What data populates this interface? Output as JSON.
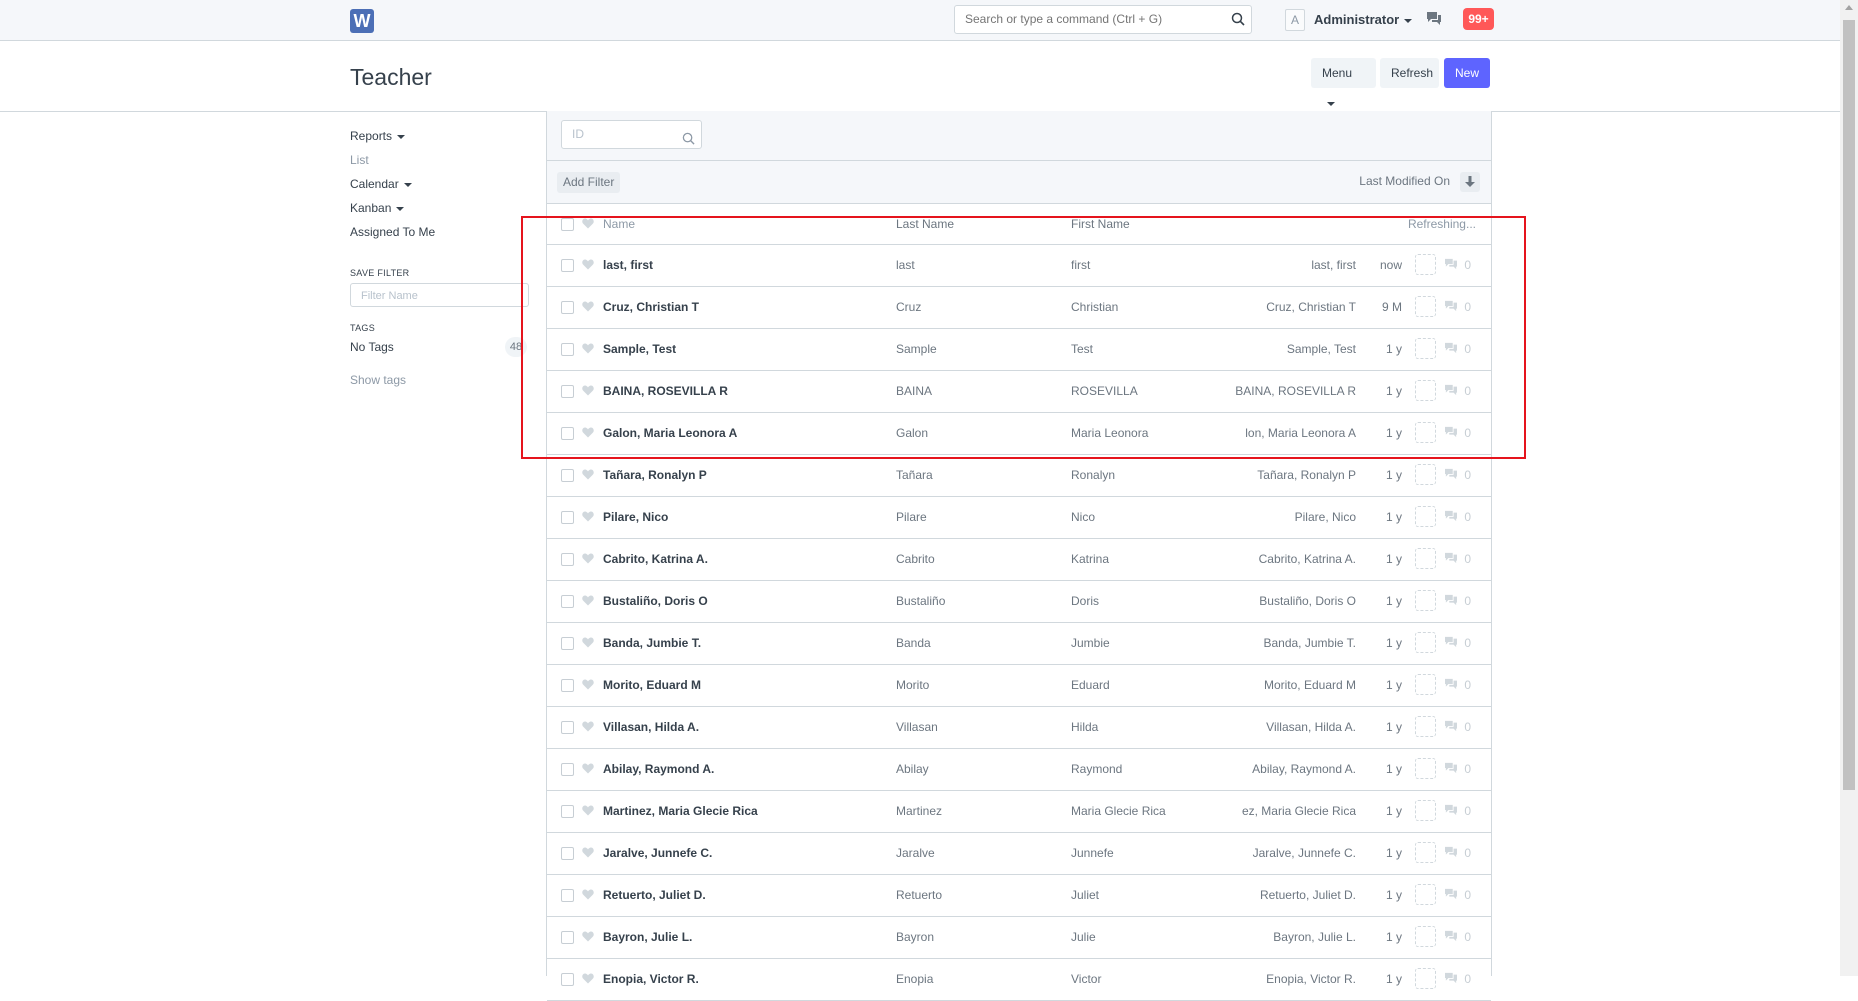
{
  "navbar": {
    "logo": "W",
    "search_placeholder": "Search or type a command (Ctrl + G)",
    "avatar_letter": "A",
    "user": "Administrator",
    "notifications": "99+"
  },
  "page": {
    "title": "Teacher",
    "menu_label": "Menu",
    "refresh_label": "Refresh",
    "new_label": "New"
  },
  "sidebar": {
    "reports": "Reports",
    "list": "List",
    "calendar": "Calendar",
    "kanban": "Kanban",
    "assigned": "Assigned To Me",
    "save_filter_label": "SAVE FILTER",
    "filter_name_placeholder": "Filter Name",
    "tags_label": "TAGS",
    "no_tags": "No Tags",
    "no_tags_count": "48",
    "show_tags": "Show tags"
  },
  "list": {
    "id_placeholder": "ID",
    "add_filter": "Add Filter",
    "sort_label": "Last Modified On",
    "columns": {
      "name": "Name",
      "last": "Last Name",
      "first": "First Name",
      "status": "Refreshing..."
    },
    "rows": [
      {
        "name": "last, first",
        "last": "last",
        "first": "first",
        "full": "last, first",
        "time": "now",
        "comments": "0"
      },
      {
        "name": "Cruz, Christian T",
        "last": "Cruz",
        "first": "Christian",
        "full": "Cruz, Christian T",
        "time": "9 M",
        "comments": "0"
      },
      {
        "name": "Sample, Test",
        "last": "Sample",
        "first": "Test",
        "full": "Sample, Test",
        "time": "1 y",
        "comments": "0"
      },
      {
        "name": "BAINA, ROSEVILLA R",
        "last": "BAINA",
        "first": "ROSEVILLA",
        "full": "BAINA, ROSEVILLA R",
        "time": "1 y",
        "comments": "0"
      },
      {
        "name": "Galon, Maria Leonora A",
        "last": "Galon",
        "first": "Maria Leonora",
        "full": "lon, Maria Leonora A",
        "time": "1 y",
        "comments": "0"
      },
      {
        "name": "Tañara, Ronalyn P",
        "last": "Tañara",
        "first": "Ronalyn",
        "full": "Tañara, Ronalyn P",
        "time": "1 y",
        "comments": "0"
      },
      {
        "name": "Pilare, Nico",
        "last": "Pilare",
        "first": "Nico",
        "full": "Pilare, Nico",
        "time": "1 y",
        "comments": "0"
      },
      {
        "name": "Cabrito, Katrina A.",
        "last": "Cabrito",
        "first": "Katrina",
        "full": "Cabrito, Katrina A.",
        "time": "1 y",
        "comments": "0"
      },
      {
        "name": "Bustaliño, Doris O",
        "last": "Bustaliño",
        "first": "Doris",
        "full": "Bustaliño, Doris O",
        "time": "1 y",
        "comments": "0"
      },
      {
        "name": "Banda, Jumbie T.",
        "last": "Banda",
        "first": "Jumbie",
        "full": "Banda, Jumbie T.",
        "time": "1 y",
        "comments": "0"
      },
      {
        "name": "Morito, Eduard M",
        "last": "Morito",
        "first": "Eduard",
        "full": "Morito, Eduard M",
        "time": "1 y",
        "comments": "0"
      },
      {
        "name": "Villasan, Hilda A.",
        "last": "Villasan",
        "first": "Hilda",
        "full": "Villasan, Hilda A.",
        "time": "1 y",
        "comments": "0"
      },
      {
        "name": "Abilay, Raymond A.",
        "last": "Abilay",
        "first": "Raymond",
        "full": "Abilay, Raymond A.",
        "time": "1 y",
        "comments": "0"
      },
      {
        "name": "Martinez, Maria Glecie Rica",
        "last": "Martinez",
        "first": "Maria Glecie Rica",
        "full": "ez, Maria Glecie Rica",
        "time": "1 y",
        "comments": "0"
      },
      {
        "name": "Jaralve, Junnefe C.",
        "last": "Jaralve",
        "first": "Junnefe",
        "full": "Jaralve, Junnefe C.",
        "time": "1 y",
        "comments": "0"
      },
      {
        "name": "Retuerto, Juliet D.",
        "last": "Retuerto",
        "first": "Juliet",
        "full": "Retuerto, Juliet D.",
        "time": "1 y",
        "comments": "0"
      },
      {
        "name": "Bayron, Julie L.",
        "last": "Bayron",
        "first": "Julie",
        "full": "Bayron, Julie L.",
        "time": "1 y",
        "comments": "0"
      },
      {
        "name": "Enopia, Victor R.",
        "last": "Enopia",
        "first": "Victor",
        "full": "Enopia, Victor R.",
        "time": "1 y",
        "comments": "0"
      }
    ]
  },
  "colors": {
    "primary": "#5e64ff",
    "notification": "#ff5858",
    "highlight_box": "#e5141d"
  }
}
